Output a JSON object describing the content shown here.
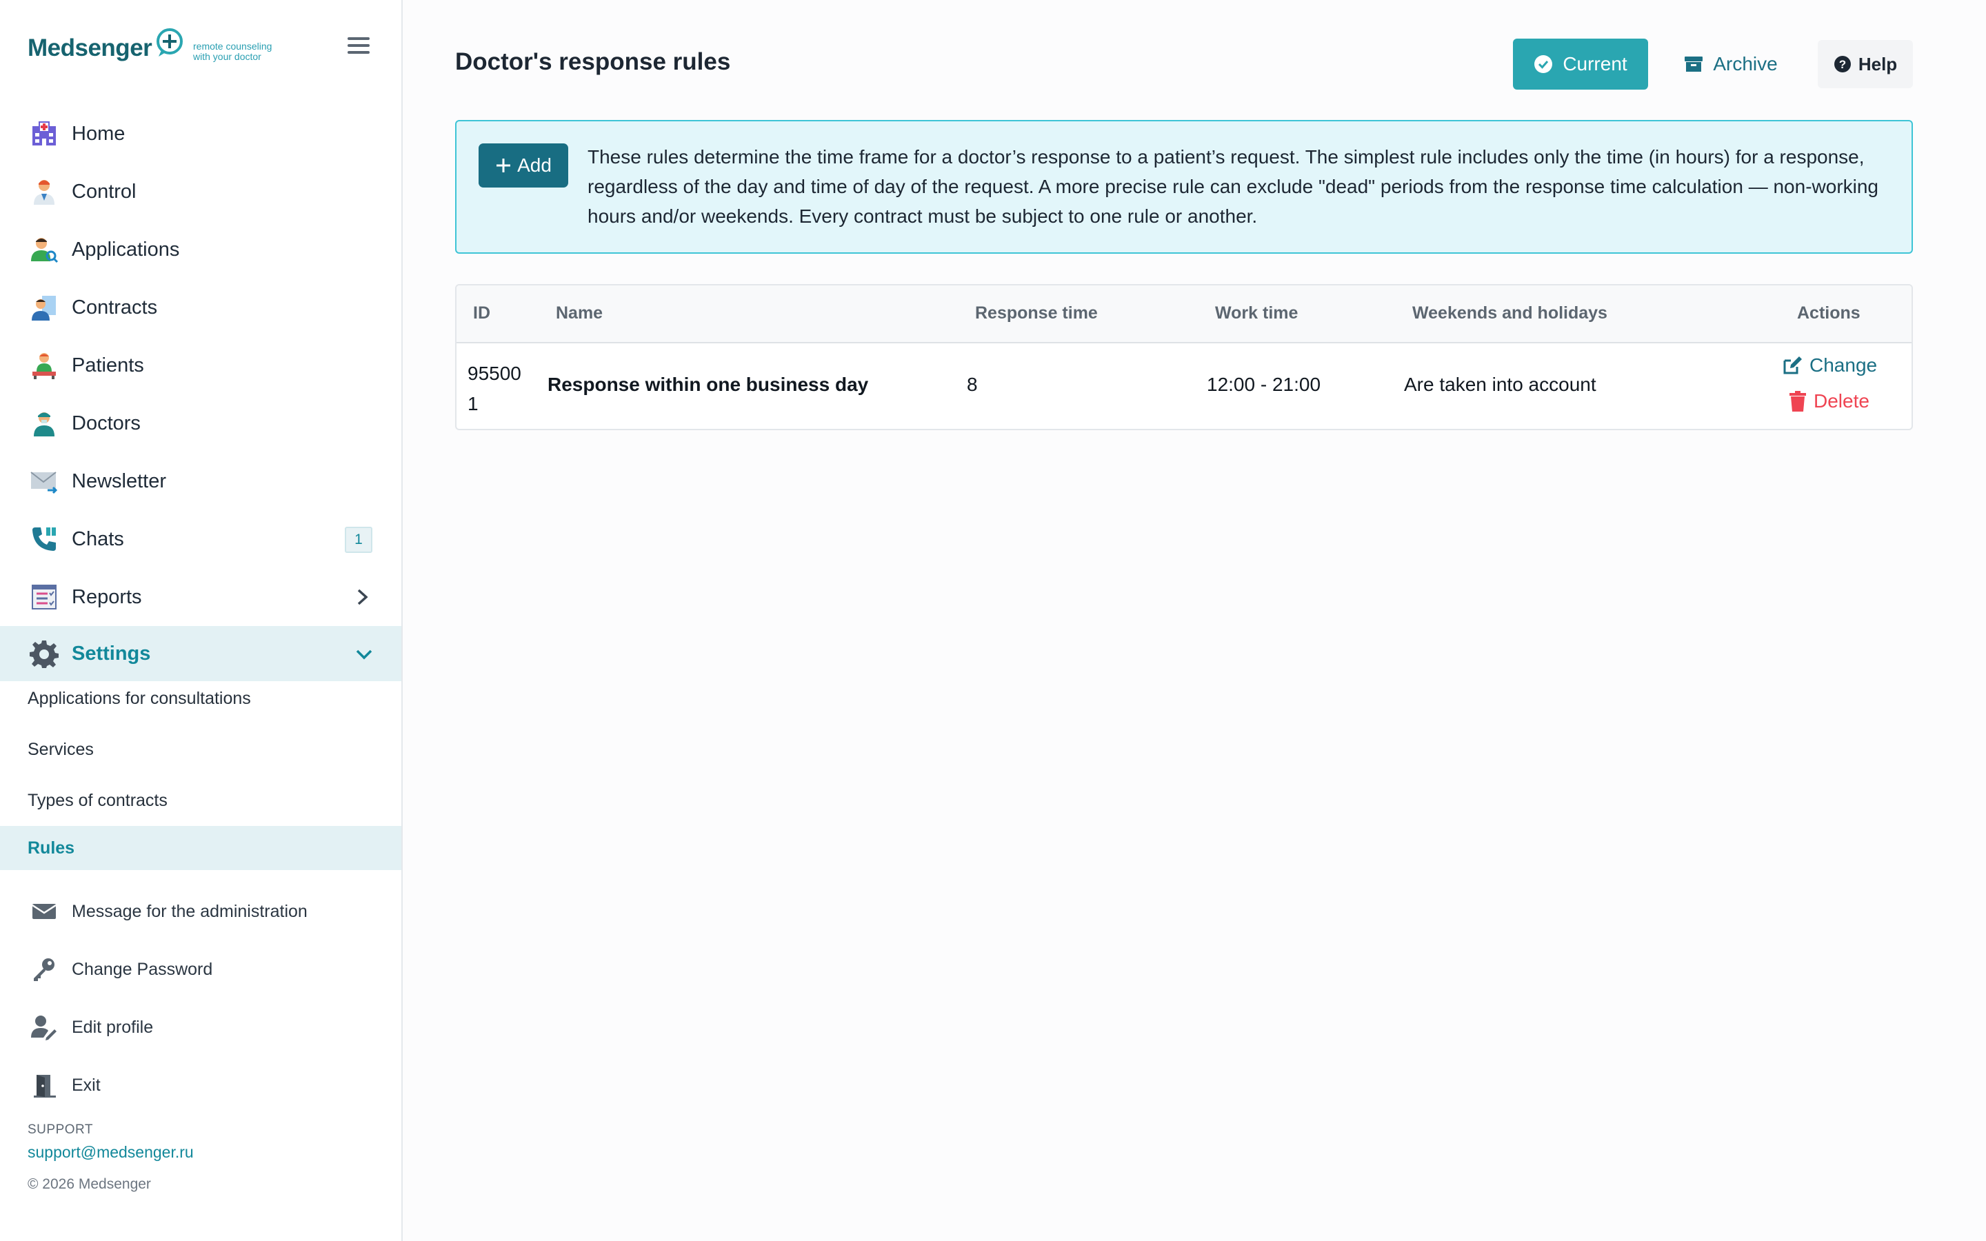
{
  "brand": {
    "name": "Medsenger",
    "tagline_line1": "remote counseling",
    "tagline_line2": "with your doctor"
  },
  "sidebar": {
    "items": [
      {
        "label": "Home",
        "icon": "hospital-icon"
      },
      {
        "label": "Control",
        "icon": "doctor-icon"
      },
      {
        "label": "Applications",
        "icon": "user-search-icon"
      },
      {
        "label": "Contracts",
        "icon": "contract-icon"
      },
      {
        "label": "Patients",
        "icon": "patient-icon"
      },
      {
        "label": "Doctors",
        "icon": "doctors-icon"
      },
      {
        "label": "Newsletter",
        "icon": "envelope-icon"
      },
      {
        "label": "Chats",
        "icon": "phone-icon",
        "badge": "1"
      },
      {
        "label": "Reports",
        "icon": "report-icon"
      },
      {
        "label": "Settings",
        "icon": "gear-icon"
      }
    ],
    "settings_subitems": [
      "Applications for consultations",
      "Services",
      "Types of contracts",
      "Rules"
    ],
    "bottom_items": [
      {
        "label": "Message for the administration",
        "icon": "envelope-icon"
      },
      {
        "label": "Change Password",
        "icon": "key-icon"
      },
      {
        "label": "Edit profile",
        "icon": "user-edit-icon"
      },
      {
        "label": "Exit",
        "icon": "door-exit-icon"
      }
    ],
    "support_label": "SUPPORT",
    "support_email": "support@medsenger.ru",
    "copyright": "© 2026 Medsenger"
  },
  "main": {
    "title": "Doctor's response rules",
    "buttons": {
      "current": "Current",
      "archive": "Archive",
      "help": "Help",
      "add": "Add"
    },
    "info_text": "These rules determine the time frame for a doctor’s response to a patient’s request. The simplest rule includes only the time (in hours) for a response, regardless of the day and time of day of the request. A more precise rule can exclude \"dead\" periods from the response time calculation — non-working hours and/or weekends. Every contract must be subject to one rule or another.",
    "table": {
      "headers": [
        "ID",
        "Name",
        "Response time",
        "Work time",
        "Weekends and holidays",
        "Actions"
      ],
      "rows": [
        {
          "id_line1": "95500",
          "id_line2": "1",
          "name": "Response within one business day",
          "response_time": "8",
          "work_time": "12:00 - 21:00",
          "weekends": "Are taken into account",
          "action_change": "Change",
          "action_delete": "Delete"
        }
      ]
    }
  },
  "colors": {
    "accent": "#2aa6b1",
    "dark_teal": "#186d82",
    "delete_red": "#ef4452",
    "info_bg": "#e2f6fa",
    "info_border": "#3ec4d6",
    "active_bg": "#e3f1f4"
  }
}
